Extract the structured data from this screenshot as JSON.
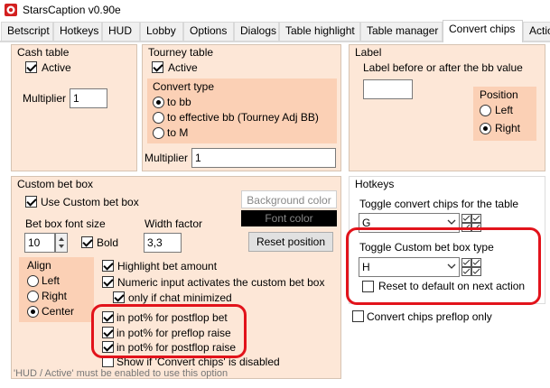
{
  "window": {
    "title": "StarsCaption v0.90e"
  },
  "tabs": [
    {
      "label": "Betscript"
    },
    {
      "label": "Hotkeys"
    },
    {
      "label": "HUD"
    },
    {
      "label": "Lobby"
    },
    {
      "label": "Options"
    },
    {
      "label": "Dialogs"
    },
    {
      "label": "Table highlight"
    },
    {
      "label": "Table manager"
    },
    {
      "label": "Convert chips"
    },
    {
      "label": "Actio"
    }
  ],
  "cash_table": {
    "title": "Cash table",
    "active_label": "Active",
    "active_checked": true,
    "multiplier_label": "Multiplier",
    "multiplier_value": "1"
  },
  "tourney_table": {
    "title": "Tourney table",
    "active_label": "Active",
    "active_checked": true,
    "convert_type_title": "Convert type",
    "options": [
      "to bb",
      "to effective bb (Tourney Adj BB)",
      "to M"
    ],
    "selected_option": "to bb",
    "multiplier_label": "Multiplier",
    "multiplier_value": "1"
  },
  "label_group": {
    "title": "Label",
    "description": "Label before or after the bb value",
    "label_value": "",
    "position_title": "Position",
    "left_label": "Left",
    "right_label": "Right",
    "selected": "Right"
  },
  "custom_bet_box": {
    "title": "Custom bet box",
    "use_label": "Use Custom bet box",
    "use_checked": true,
    "background_color_label": "Background color",
    "font_color_label": "Font color",
    "font_size_label": "Bet box font size",
    "font_size_value": "10",
    "bold_label": "Bold",
    "bold_checked": true,
    "width_factor_label": "Width factor",
    "width_factor_value": "3,3",
    "reset_position_label": "Reset position",
    "align_title": "Align",
    "align_left": "Left",
    "align_right": "Right",
    "align_center": "Center",
    "align_selected": "Center",
    "highlight_label": "Highlight bet amount",
    "numeric_label": "Numeric input activates the custom bet box",
    "only_chat_label": "only if chat minimized",
    "pot_postflop_bet": "in pot% for postflop bet",
    "pot_preflop_raise": "in pot% for preflop raise",
    "pot_postflop_raise": "in pot% for postflop raise",
    "show_disabled_label": "Show if 'Convert chips' is disabled",
    "footnote": "'HUD / Active' must be enabled to use this option"
  },
  "hotkeys": {
    "title": "Hotkeys",
    "toggle_convert_label": "Toggle convert chips for the table",
    "toggle_convert_value": "G",
    "toggle_custom_label": "Toggle Custom bet box type",
    "toggle_custom_value": "H",
    "reset_default_label": "Reset to default on next action",
    "reset_default_checked": false
  },
  "preflop": {
    "label": "Convert chips preflop only",
    "checked": false
  },
  "colors": {
    "group_bg": "#fde7d7",
    "subgroup_bg": "#fbd0b5",
    "annotation_red": "#e2131b",
    "font_color_swatch": "#000000"
  }
}
